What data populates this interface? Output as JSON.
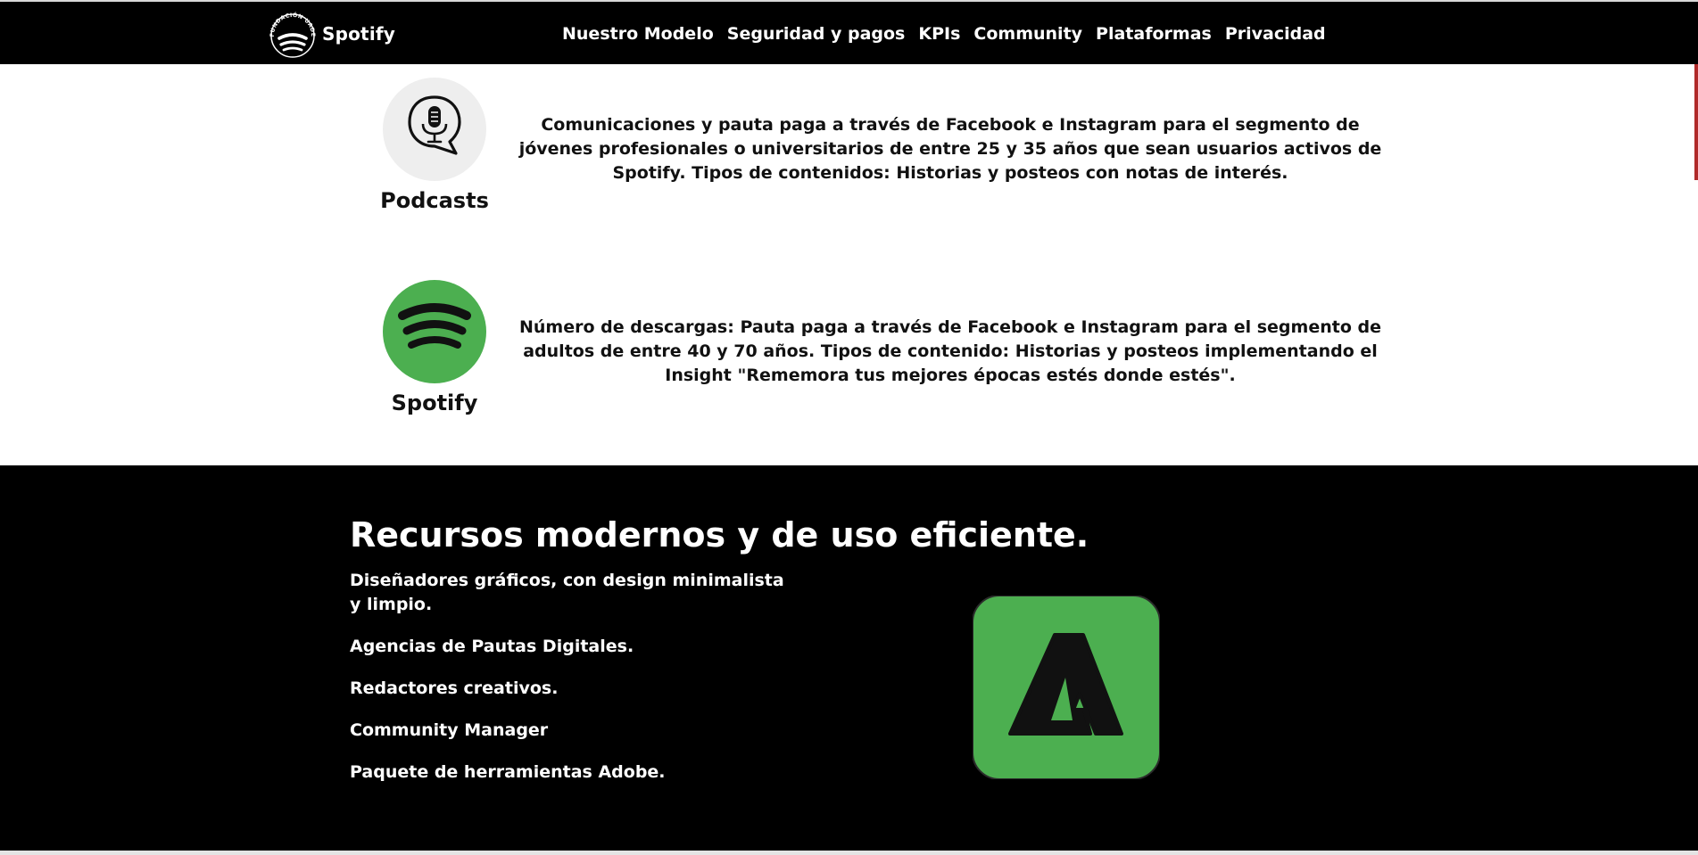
{
  "header": {
    "brand_name": "Spotify",
    "logo_arc_text": "FUNDACIÓN UADE",
    "nav": [
      {
        "label": "Nuestro Modelo"
      },
      {
        "label": "Seguridad y pagos"
      },
      {
        "label": "KPIs"
      },
      {
        "label": "Community"
      },
      {
        "label": "Plataformas"
      },
      {
        "label": "Privacidad"
      }
    ]
  },
  "channels": [
    {
      "title": "Podcasts",
      "icon": "podcast-microphone-icon",
      "description": "Comunicaciones y pauta paga a través de Facebook e Instagram para el segmento de jóvenes profesionales o universitarios de entre 25 y 35 años que sean usuarios activos de Spotify. Tipos de contenidos: Historias y posteos con notas de interés."
    },
    {
      "title": "Spotify",
      "icon": "spotify-logo-icon",
      "description": "Número de descargas: Pauta paga a través de Facebook e Instagram para el segmento de adultos de entre 40 y 70 años. Tipos de contenido: Historias y posteos implementando el Insight \"Rememora tus mejores épocas estés donde estés\"."
    }
  ],
  "resources": {
    "title": "Recursos modernos y de uso eficiente.",
    "items": [
      "Diseñadores gráficos, con design minimalista y limpio.",
      "Agencias de Pautas Digitales.",
      "Redactores creativos.",
      "Community Manager",
      "Paquete de herramientas Adobe."
    ],
    "icon": "adobe-icon"
  },
  "colors": {
    "spotify_green": "#4caf50",
    "podcast_bg": "#eeeeee",
    "black": "#000000",
    "white": "#ffffff"
  }
}
